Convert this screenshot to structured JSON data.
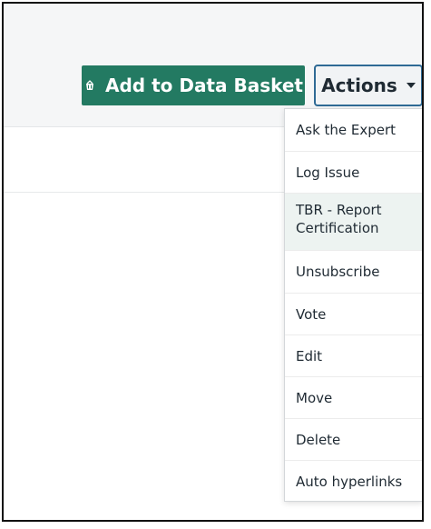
{
  "toolbar": {
    "add_to_data_basket_label": "Add to Data Basket",
    "actions_label": "Actions"
  },
  "menu": {
    "items": [
      {
        "label": "Ask the Expert"
      },
      {
        "label": "Log Issue"
      },
      {
        "label": "TBR - Report\nCertification"
      },
      {
        "label": "Unsubscribe"
      },
      {
        "label": "Vote"
      },
      {
        "label": "Edit"
      },
      {
        "label": "Move"
      },
      {
        "label": "Delete"
      },
      {
        "label": "Auto hyperlinks"
      }
    ],
    "highlighted_item": "TBR - Report\nCertification"
  },
  "colors": {
    "primary_button": "#237a62",
    "actions_border": "#2f6a95",
    "highlight_bg": "#edf3f1",
    "text_dark": "#1f2a33"
  },
  "icons": {
    "add_button_icon": "basket-icon",
    "actions_caret_icon": "chevron-down-icon"
  }
}
